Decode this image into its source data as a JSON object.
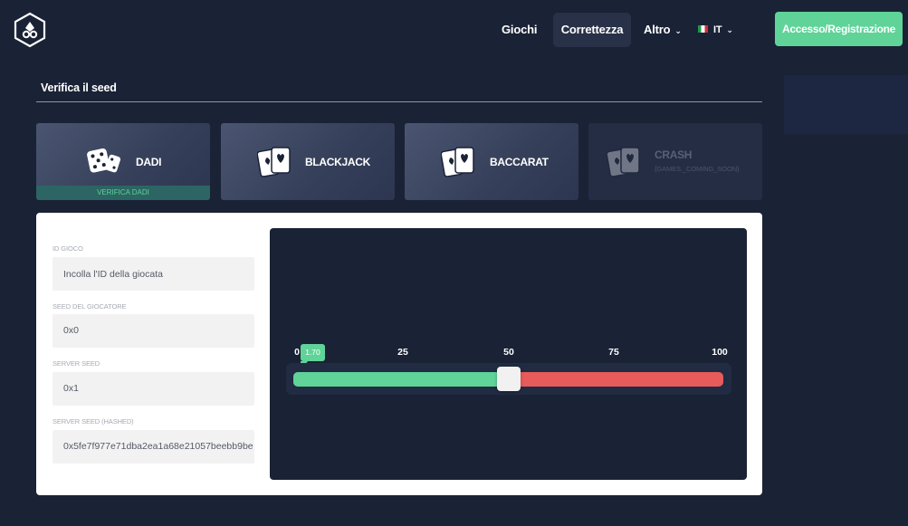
{
  "header": {
    "nav": [
      {
        "label": "Giochi"
      },
      {
        "label": "Correttezza"
      },
      {
        "label": "Altro"
      }
    ],
    "language": "IT",
    "login_label": "Accesso/Registrazione"
  },
  "page": {
    "title": "Verifica il seed"
  },
  "games": [
    {
      "label": "DADI",
      "icon": "dice-icon",
      "verify_label": "VERIFICA DADI",
      "selected": true
    },
    {
      "label": "BLACKJACK",
      "icon": "cards-icon"
    },
    {
      "label": "BACCARAT",
      "icon": "cards-icon"
    },
    {
      "label": "CRASH",
      "icon": "cards-icon",
      "sublabel": "{GAMES._COMING_SOON}",
      "disabled": true
    }
  ],
  "form": {
    "game_id": {
      "label": "ID GIOCO",
      "placeholder": "Incolla l'ID della giocata"
    },
    "player_seed": {
      "label": "SEED DEL GIOCATORE",
      "value": "0x0"
    },
    "server_seed": {
      "label": "SERVER SEED",
      "value": "0x1"
    },
    "server_seed_hashed": {
      "label": "SERVER SEED (HASHED)",
      "value": "0x5fe7f977e71dba2ea1a68e21057beebb9be"
    }
  },
  "slider": {
    "ticks": [
      "0",
      "25",
      "50",
      "75",
      "100"
    ],
    "result": "1.70",
    "value": 50,
    "colors": {
      "win": "#5fd398",
      "lose": "#e85b5b"
    }
  },
  "colors": {
    "background": "#1a2236",
    "accent": "#5fd398"
  }
}
